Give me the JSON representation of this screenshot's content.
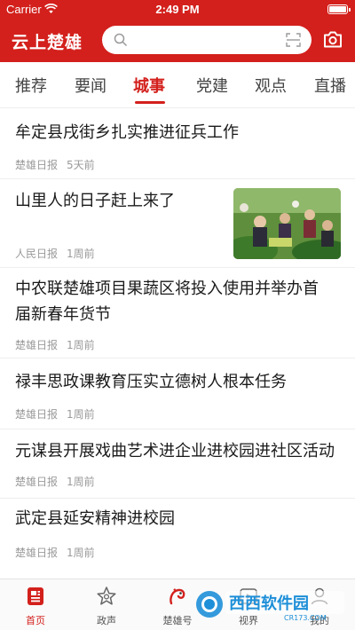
{
  "status_bar": {
    "carrier": "Carrier",
    "time": "2:49 PM"
  },
  "header": {
    "logo": "云上楚雄",
    "search_placeholder": "",
    "accent": "#d3201c"
  },
  "tabs": [
    {
      "label": "推荐",
      "active": false
    },
    {
      "label": "要闻",
      "active": false
    },
    {
      "label": "城事",
      "active": true
    },
    {
      "label": "党建",
      "active": false
    },
    {
      "label": "观点",
      "active": false
    },
    {
      "label": "直播",
      "active": false
    }
  ],
  "articles": [
    {
      "title": "牟定县戌街乡扎实推进征兵工作",
      "source": "楚雄日报",
      "time": "5天前"
    },
    {
      "title": "山里人的日子赶上来了",
      "source": "人民日报",
      "time": "1周前",
      "has_image": true
    },
    {
      "title": "中农联楚雄项目果蔬区将投入使用并举办首届新春年货节",
      "title_line1": " 中农联楚雄项目果蔬区将投入使用并举办首",
      "title_line2": "届新春年货节",
      "source": "楚雄日报",
      "time": "1周前"
    },
    {
      "title": "禄丰思政课教育压实立德树人根本任务",
      "source": "楚雄日报",
      "time": "1周前"
    },
    {
      "title": "元谋县开展戏曲艺术进企业进校园进社区活动",
      "source": "楚雄日报",
      "time": "1周前"
    },
    {
      "title": "武定县延安精神进校园",
      "source": "楚雄日报",
      "time": "1周前"
    }
  ],
  "bottom_nav": [
    {
      "label": "首页",
      "icon": "news-icon",
      "active": true
    },
    {
      "label": "政声",
      "icon": "star-icon",
      "active": false
    },
    {
      "label": "楚雄号",
      "icon": "mascot-icon",
      "active": false
    },
    {
      "label": "视界",
      "icon": "video-icon",
      "active": false
    },
    {
      "label": "我的",
      "icon": "user-icon",
      "active": false
    }
  ],
  "watermark": {
    "brand": "西西软件园",
    "domain": "CR173.COM"
  }
}
